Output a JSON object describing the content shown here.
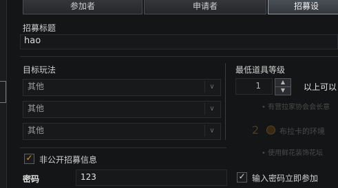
{
  "tabs": [
    {
      "label": "参加者"
    },
    {
      "label": "申请者"
    },
    {
      "label": "招募设"
    }
  ],
  "recruit_title": {
    "label": "招募标题",
    "value": "hao"
  },
  "target_play": {
    "label": "目标玩法",
    "options": [
      "其他",
      "其他",
      "其他"
    ]
  },
  "min_item_level": {
    "label": "最低道具等级",
    "value": "1",
    "suffix": "以上可以"
  },
  "private_recruit": {
    "label": "非公开招募信息",
    "checked": true
  },
  "password": {
    "label": "密码",
    "value": "123"
  },
  "enter_password_join": {
    "label": "输入密码立即参加",
    "checked": true
  },
  "ghost": {
    "step_number": "2",
    "line1": "布拉卡的环境",
    "line2": "• 有营拉家协会会长意",
    "line3": "• 使用鲜花装饰花坛"
  },
  "colors": {
    "accent_check": "#e09a2c",
    "background": "#141516"
  }
}
